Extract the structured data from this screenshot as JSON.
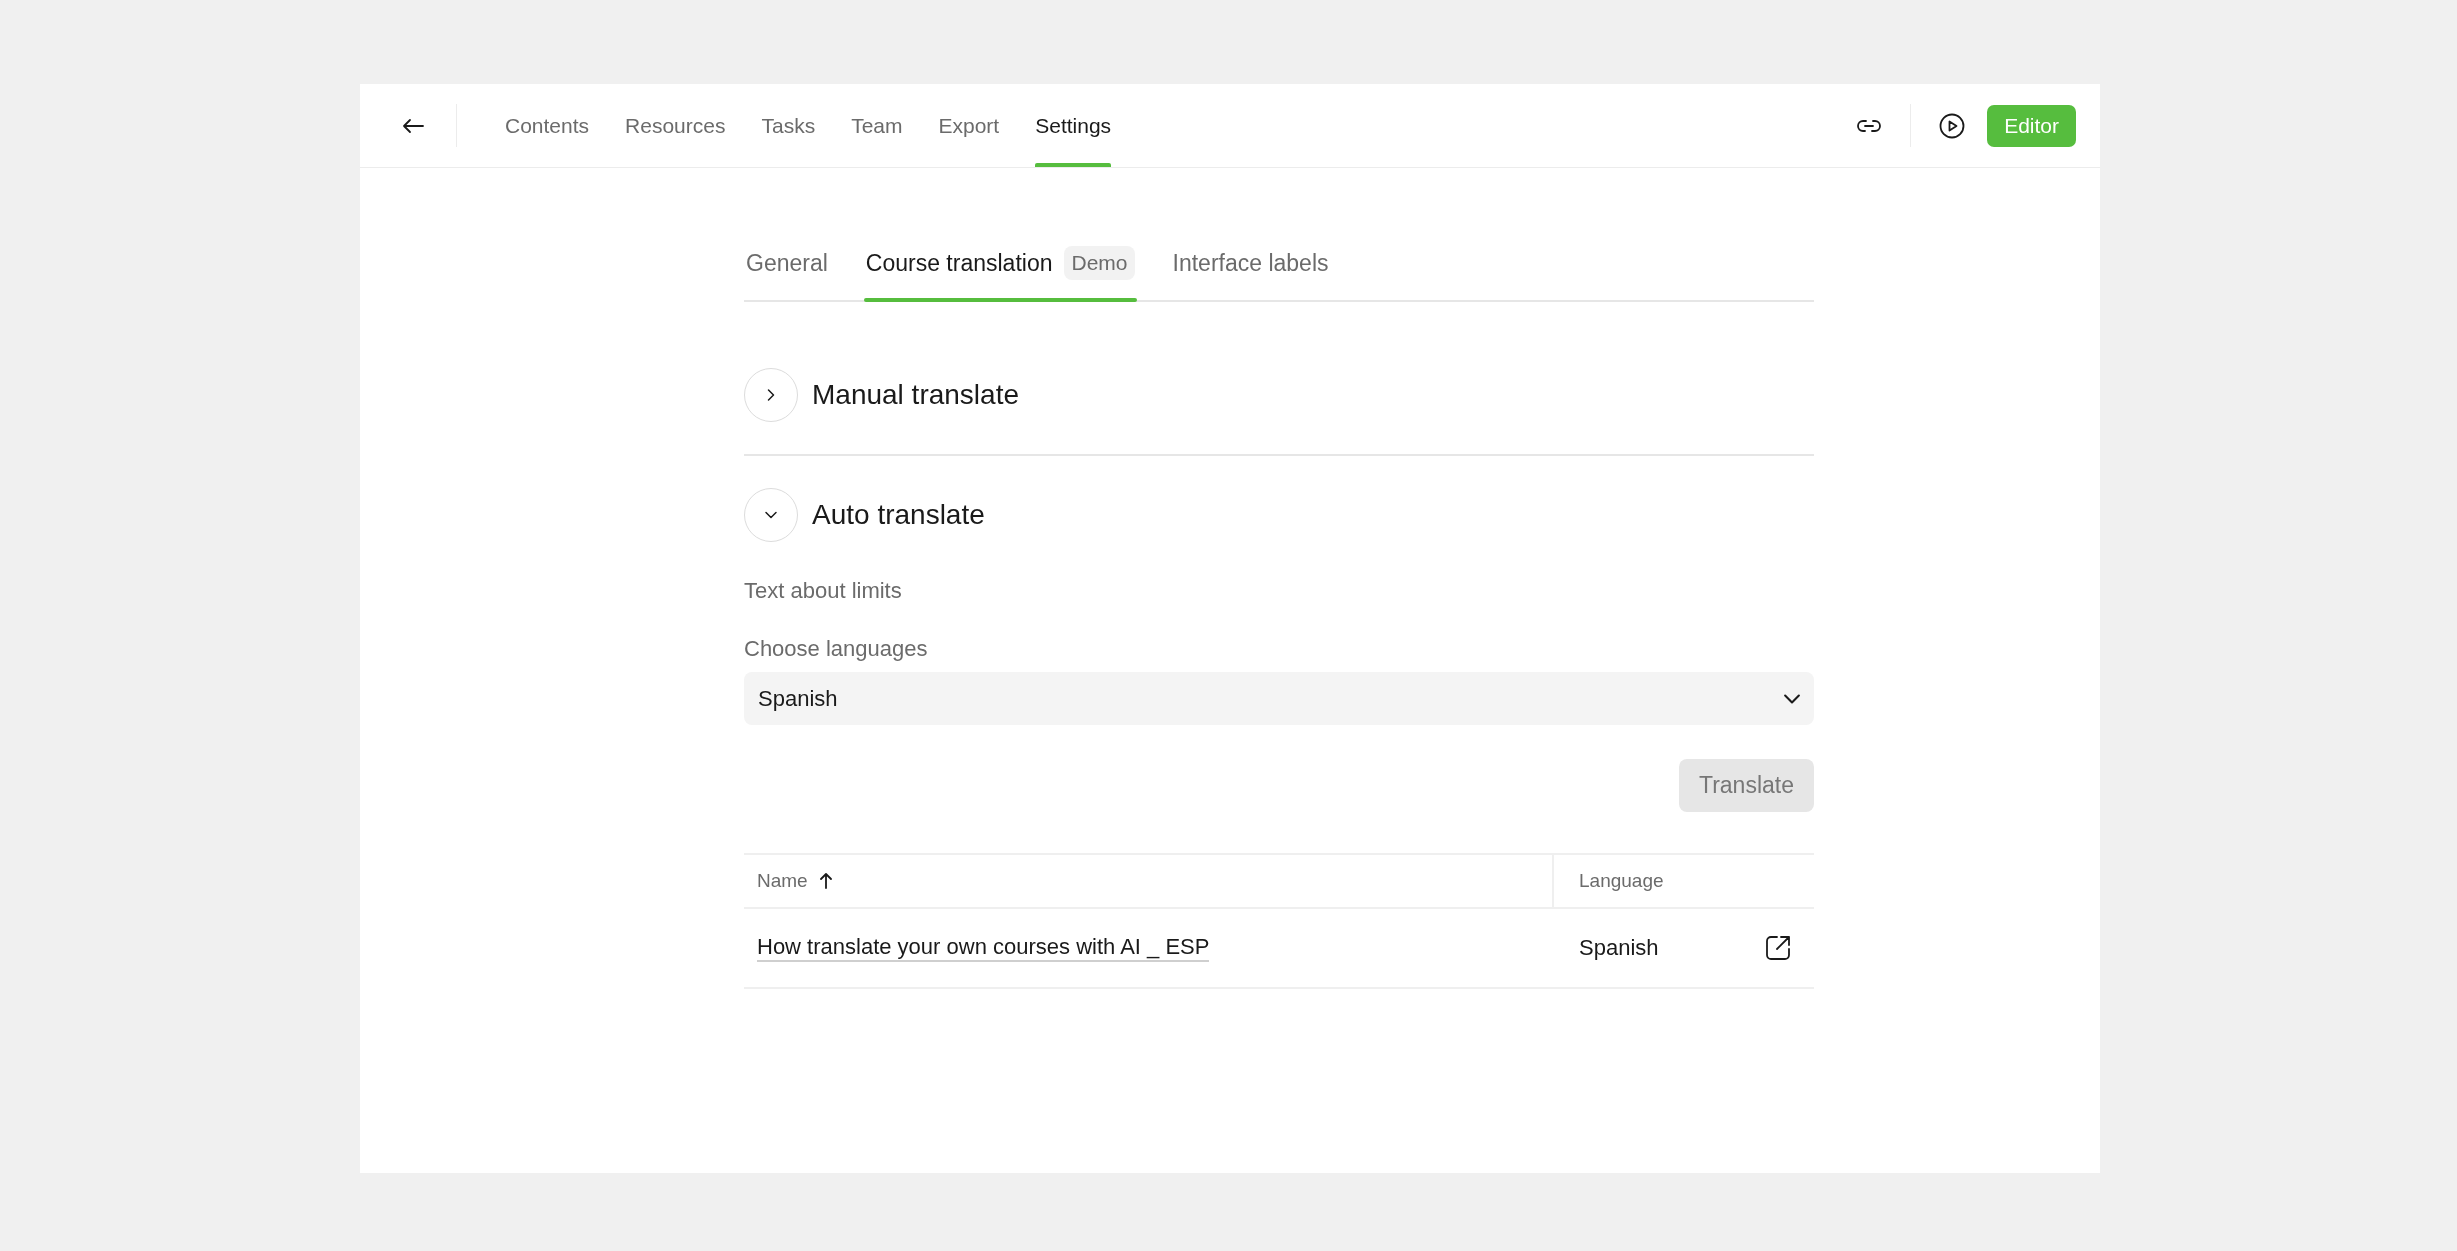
{
  "top_bar": {
    "nav": [
      {
        "label": "Contents",
        "selected": false
      },
      {
        "label": "Resources",
        "selected": false
      },
      {
        "label": "Tasks",
        "selected": false
      },
      {
        "label": "Team",
        "selected": false
      },
      {
        "label": "Export",
        "selected": false
      },
      {
        "label": "Settings",
        "selected": true
      }
    ],
    "editor_button": "Editor"
  },
  "tabs": [
    {
      "label": "General",
      "selected": false
    },
    {
      "label": "Course translation",
      "selected": true,
      "badge": "Demo"
    },
    {
      "label": "Interface labels",
      "selected": false
    }
  ],
  "sections": [
    {
      "title": "Manual translate",
      "expanded": false
    },
    {
      "title": "Auto translate",
      "expanded": true,
      "limits_text": "Text about limits",
      "language_label": "Choose languages",
      "language_value": "Spanish",
      "translate_button": {
        "label": "Translate",
        "disabled": true
      },
      "table": {
        "columns": [
          {
            "label": "Name",
            "sorted_ascending": true
          },
          {
            "label": "Language"
          }
        ],
        "rows": [
          {
            "name": "How translate your own courses with AI _ ESP",
            "language": "Spanish"
          }
        ]
      }
    }
  ]
}
